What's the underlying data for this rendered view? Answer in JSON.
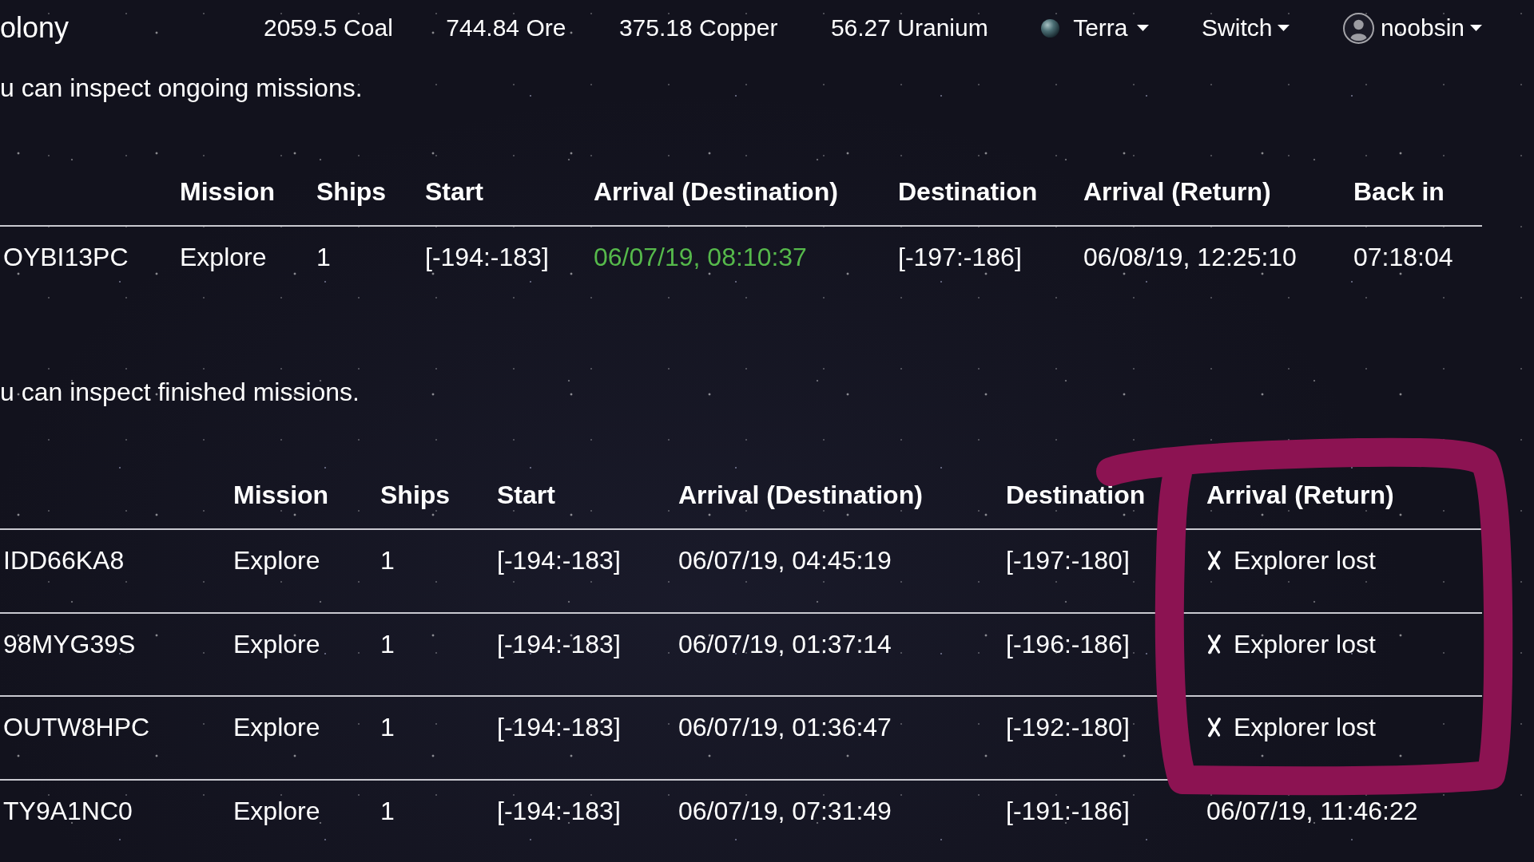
{
  "navbar": {
    "brand": "olony",
    "resources": [
      "2059.5 Coal",
      "744.84 Ore",
      "375.18 Copper",
      "56.27 Uranium"
    ],
    "planet_menu": {
      "label": "Terra"
    },
    "switch_menu": {
      "label": "Switch"
    },
    "user_menu": {
      "label": "noobsin"
    }
  },
  "ongoing_missions": {
    "intro": "u can inspect ongoing missions.",
    "columns": [
      {},
      {
        "label": "Mission"
      },
      {
        "label": "Ships"
      },
      {
        "label": "Start"
      },
      {
        "label": "Arrival (Destination)"
      },
      {
        "label": "Destination"
      },
      {
        "label": "Arrival (Return)"
      },
      {
        "label": "Back in"
      }
    ],
    "rows": [
      {
        "cells": [
          {
            "text": "OYBI13PC",
            "kind": "plain"
          },
          {
            "text": "Explore",
            "kind": "plain"
          },
          {
            "text": "1",
            "kind": "plain"
          },
          {
            "text": "[-194:-183]",
            "kind": "plain"
          },
          {
            "text": "06/07/19, 08:10:37",
            "kind": "success"
          },
          {
            "text": "[-197:-186]",
            "kind": "plain"
          },
          {
            "text": "06/08/19, 12:25:10",
            "kind": "plain"
          },
          {
            "text": "07:18:04",
            "kind": "plain"
          }
        ]
      }
    ]
  },
  "finished_missions": {
    "intro": "u can inspect finished missions.",
    "columns": [
      {
        "circled": false
      },
      {
        "label": "Mission",
        "circled": false
      },
      {
        "label": "Ships",
        "circled": false
      },
      {
        "label": "Start",
        "circled": false
      },
      {
        "label": "Arrival (Destination)",
        "circled": false
      },
      {
        "label": "Destination",
        "circled": false
      },
      {
        "label": "Arrival (Return)",
        "circled": true
      }
    ],
    "rows": [
      {
        "cells": [
          {
            "text": "IDD66KA8",
            "kind": "plain"
          },
          {
            "text": "Explore",
            "kind": "plain"
          },
          {
            "text": "1",
            "kind": "plain"
          },
          {
            "text": "[-194:-183]",
            "kind": "plain"
          },
          {
            "text": "06/07/19, 04:45:19",
            "kind": "plain"
          },
          {
            "text": "[-197:-180]",
            "kind": "plain"
          },
          {
            "text": "Explorer lost",
            "kind": "failure"
          }
        ]
      },
      {
        "cells": [
          {
            "text": "98MYG39S",
            "kind": "plain"
          },
          {
            "text": "Explore",
            "kind": "plain"
          },
          {
            "text": "1",
            "kind": "plain"
          },
          {
            "text": "[-194:-183]",
            "kind": "plain"
          },
          {
            "text": "06/07/19, 01:37:14",
            "kind": "plain"
          },
          {
            "text": "[-196:-186]",
            "kind": "plain"
          },
          {
            "text": "Explorer lost",
            "kind": "failure"
          }
        ]
      },
      {
        "cells": [
          {
            "text": "OUTW8HPC",
            "kind": "plain"
          },
          {
            "text": "Explore",
            "kind": "plain"
          },
          {
            "text": "1",
            "kind": "plain"
          },
          {
            "text": "[-194:-183]",
            "kind": "plain"
          },
          {
            "text": "06/07/19, 01:36:47",
            "kind": "plain"
          },
          {
            "text": "[-192:-180]",
            "kind": "plain"
          },
          {
            "text": "Explorer lost",
            "kind": "failure"
          }
        ]
      },
      {
        "cells": [
          {
            "text": "TY9A1NC0",
            "kind": "plain"
          },
          {
            "text": "Explore",
            "kind": "plain"
          },
          {
            "text": "1",
            "kind": "plain"
          },
          {
            "text": "[-194:-183]",
            "kind": "plain"
          },
          {
            "text": "06/07/19, 07:31:49",
            "kind": "plain"
          },
          {
            "text": "[-191:-186]",
            "kind": "plain"
          },
          {
            "text": "06/07/19, 11:46:22",
            "kind": "plain"
          }
        ]
      }
    ]
  }
}
